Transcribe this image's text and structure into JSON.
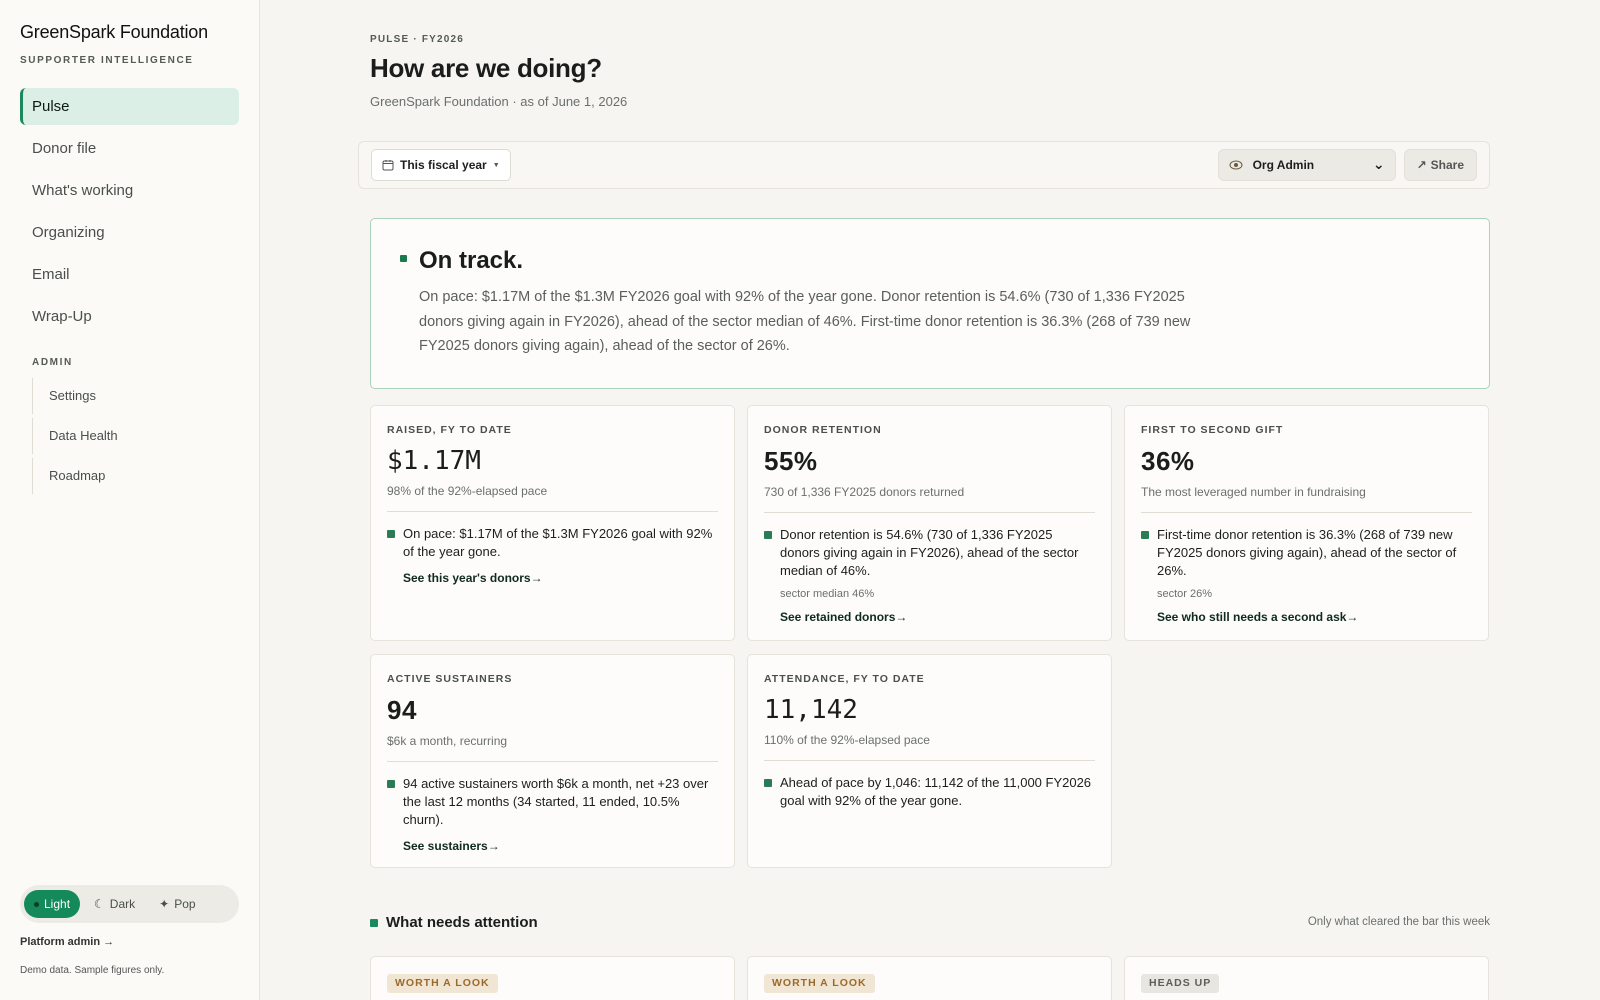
{
  "sidebar": {
    "brand": "GreenSpark Foundation",
    "subtitle": "SUPPORTER INTELLIGENCE",
    "nav": [
      "Pulse",
      "Donor file",
      "What's working",
      "Organizing",
      "Email",
      "Wrap-Up"
    ],
    "admin_label": "ADMIN",
    "admin_items": [
      "Settings",
      "Data Health",
      "Roadmap"
    ],
    "theme": {
      "light": "Light",
      "dark": "Dark",
      "pop": "Pop"
    },
    "platform_link": "Platform admin →",
    "demo_note": "Demo data. Sample figures only."
  },
  "header": {
    "eyebrow": "PULSE · FY2026",
    "title": "How are we doing?",
    "subtitle": "GreenSpark Foundation · as of June 1, 2026"
  },
  "toolbar": {
    "period": "This fiscal year",
    "role": "Org Admin",
    "share": "Share"
  },
  "status": {
    "title": "On track.",
    "body": "On pace: $1.17M of the $1.3M FY2026 goal with 92% of the year gone. Donor retention is 54.6% (730 of 1,336 FY2025 donors giving again in FY2026), ahead of the sector median of 46%. First-time donor retention is 36.3% (268 of 739 new FY2025 donors giving again), ahead of the sector of 26%."
  },
  "metrics": [
    {
      "label": "RAISED, FY TO DATE",
      "value": "$1.17M",
      "sub": "98% of the 92%-elapsed pace",
      "note": "On pace: $1.17M of the $1.3M FY2026 goal with 92% of the year gone.",
      "ref": "",
      "link": "See this year's donors→"
    },
    {
      "label": "DONOR RETENTION",
      "value": "55%",
      "sub": "730 of 1,336 FY2025 donors returned",
      "note": "Donor retention is 54.6% (730 of 1,336 FY2025 donors giving again in FY2026), ahead of the sector median of 46%.",
      "ref": "sector median 46%",
      "link": "See retained donors→"
    },
    {
      "label": "FIRST TO SECOND GIFT",
      "value": "36%",
      "sub": "The most leveraged number in fundraising",
      "note": "First-time donor retention is 36.3% (268 of 739 new FY2025 donors giving again), ahead of the sector of 26%.",
      "ref": "sector 26%",
      "link": "See who still needs a second ask→"
    },
    {
      "label": "ACTIVE SUSTAINERS",
      "value": "94",
      "sub": "$6k a month, recurring",
      "note": "94 active sustainers worth $6k a month, net +23 over the last 12 months (34 started, 11 ended, 10.5% churn).",
      "ref": "",
      "link": "See sustainers→"
    },
    {
      "label": "ATTENDANCE, FY TO DATE",
      "value": "11,142",
      "sub": "110% of the 92%-elapsed pace",
      "note": "Ahead of pace by 1,046: 11,142 of the 11,000 FY2026 goal with 92% of the year gone.",
      "ref": "",
      "link": ""
    }
  ],
  "attention": {
    "title": "What needs attention",
    "note": "Only what cleared the bar this week",
    "badges": [
      "WORTH A LOOK",
      "WORTH A LOOK",
      "HEADS UP"
    ]
  },
  "icons": {
    "calendar": "calendar-icon",
    "eye": "eye-icon",
    "share": "share-arrow-icon",
    "moon": "moon-icon",
    "sparkle": "sparkle-icon"
  },
  "colors": {
    "accent": "#148a5a",
    "active_nav_bg": "#dbefe6",
    "status_border": "#a8d3bd",
    "warn_badge": "#f1e6d3"
  }
}
